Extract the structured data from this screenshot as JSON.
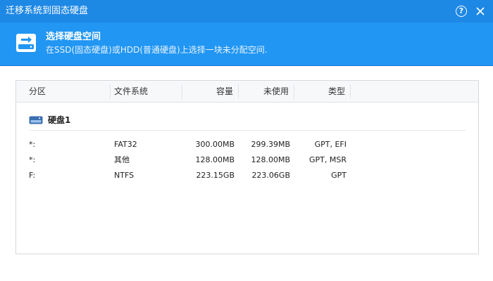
{
  "window": {
    "title": "迁移系统到固态硬盘",
    "help_glyph": "?"
  },
  "header": {
    "title": "选择硬盘空间",
    "subtitle": "在SSD(固态硬盘)或HDD(普通硬盘)上选择一块未分配空间."
  },
  "table": {
    "columns": [
      "分区",
      "文件系统",
      "容量",
      "未使用",
      "类型"
    ],
    "disk_label": "硬盘1",
    "rows": [
      {
        "partition": "*:",
        "fs": "FAT32",
        "capacity": "300.00MB",
        "free": "299.39MB",
        "type": "GPT, EFI"
      },
      {
        "partition": "*:",
        "fs": "其他",
        "capacity": "128.00MB",
        "free": "128.00MB",
        "type": "GPT, MSR"
      },
      {
        "partition": "F:",
        "fs": "NTFS",
        "capacity": "223.15GB",
        "free": "223.06GB",
        "type": "GPT"
      }
    ]
  },
  "colors": {
    "titlebar": "#1e88e5",
    "header": "#2196f3",
    "panel_border": "#d5d9de"
  },
  "icons": {
    "titlebar_help": "help-icon",
    "titlebar_close": "close-icon",
    "header": "hard-disk-icon",
    "disk_row": "disk-icon"
  }
}
